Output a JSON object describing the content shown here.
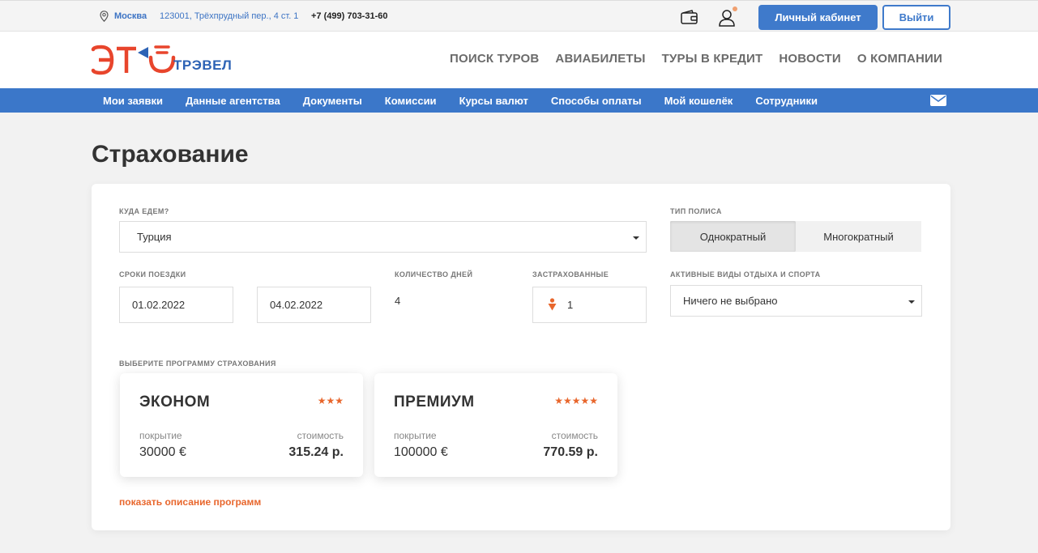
{
  "topbar": {
    "city": "Москва",
    "address": "123001, Трёхпрудный пер., 4 ст. 1",
    "phone": "+7 (499) 703-31-60",
    "cabinet_label": "Личный кабинет",
    "exit_label": "Выйти"
  },
  "logo": {
    "subtitle": "ТРЭВЕЛ"
  },
  "mainnav": [
    "ПОИСК ТУРОВ",
    "АВИАБИЛЕТЫ",
    "ТУРЫ В КРЕДИТ",
    "НОВОСТИ",
    "О КОМПАНИИ"
  ],
  "subnav": [
    "Мои заявки",
    "Данные агентства",
    "Документы",
    "Комиссии",
    "Курсы валют",
    "Способы оплаты",
    "Мой кошелёк",
    "Сотрудники"
  ],
  "page_title": "Страхование",
  "form": {
    "destination_label": "КУДА ЕДЕМ?",
    "destination_value": "Турция",
    "policy_type_label": "ТИП ПОЛИСА",
    "policy_options": [
      "Однократный",
      "Многократный"
    ],
    "policy_selected": "Однократный",
    "dates_label": "СРОКИ ПОЕЗДКИ",
    "date_from": "01.02.2022",
    "date_to": "04.02.2022",
    "days_label": "КОЛИЧЕСТВО ДНЕЙ",
    "days_value": "4",
    "insured_label": "ЗАСТРАХОВАННЫЕ",
    "insured_value": "1",
    "activities_label": "АКТИВНЫЕ ВИДЫ ОТДЫХА И СПОРТА",
    "activities_value": "Ничего не выбрано",
    "program_label": "ВЫБЕРИТЕ ПРОГРАММУ СТРАХОВАНИЯ"
  },
  "programs": [
    {
      "name": "ЭКОНОМ",
      "stars": "★★★",
      "coverage_label": "покрытие",
      "coverage": "30000 €",
      "price_label": "стоимость",
      "price": "315.24 р."
    },
    {
      "name": "ПРЕМИУМ",
      "stars": "★★★★★",
      "coverage_label": "покрытие",
      "coverage": "100000 €",
      "price_label": "стоимость",
      "price": "770.59 р."
    }
  ],
  "show_description_link": "показать описание программ",
  "colors": {
    "accent_blue": "#3b77c9",
    "accent_orange": "#e8662c",
    "logo_red": "#e8452c"
  }
}
